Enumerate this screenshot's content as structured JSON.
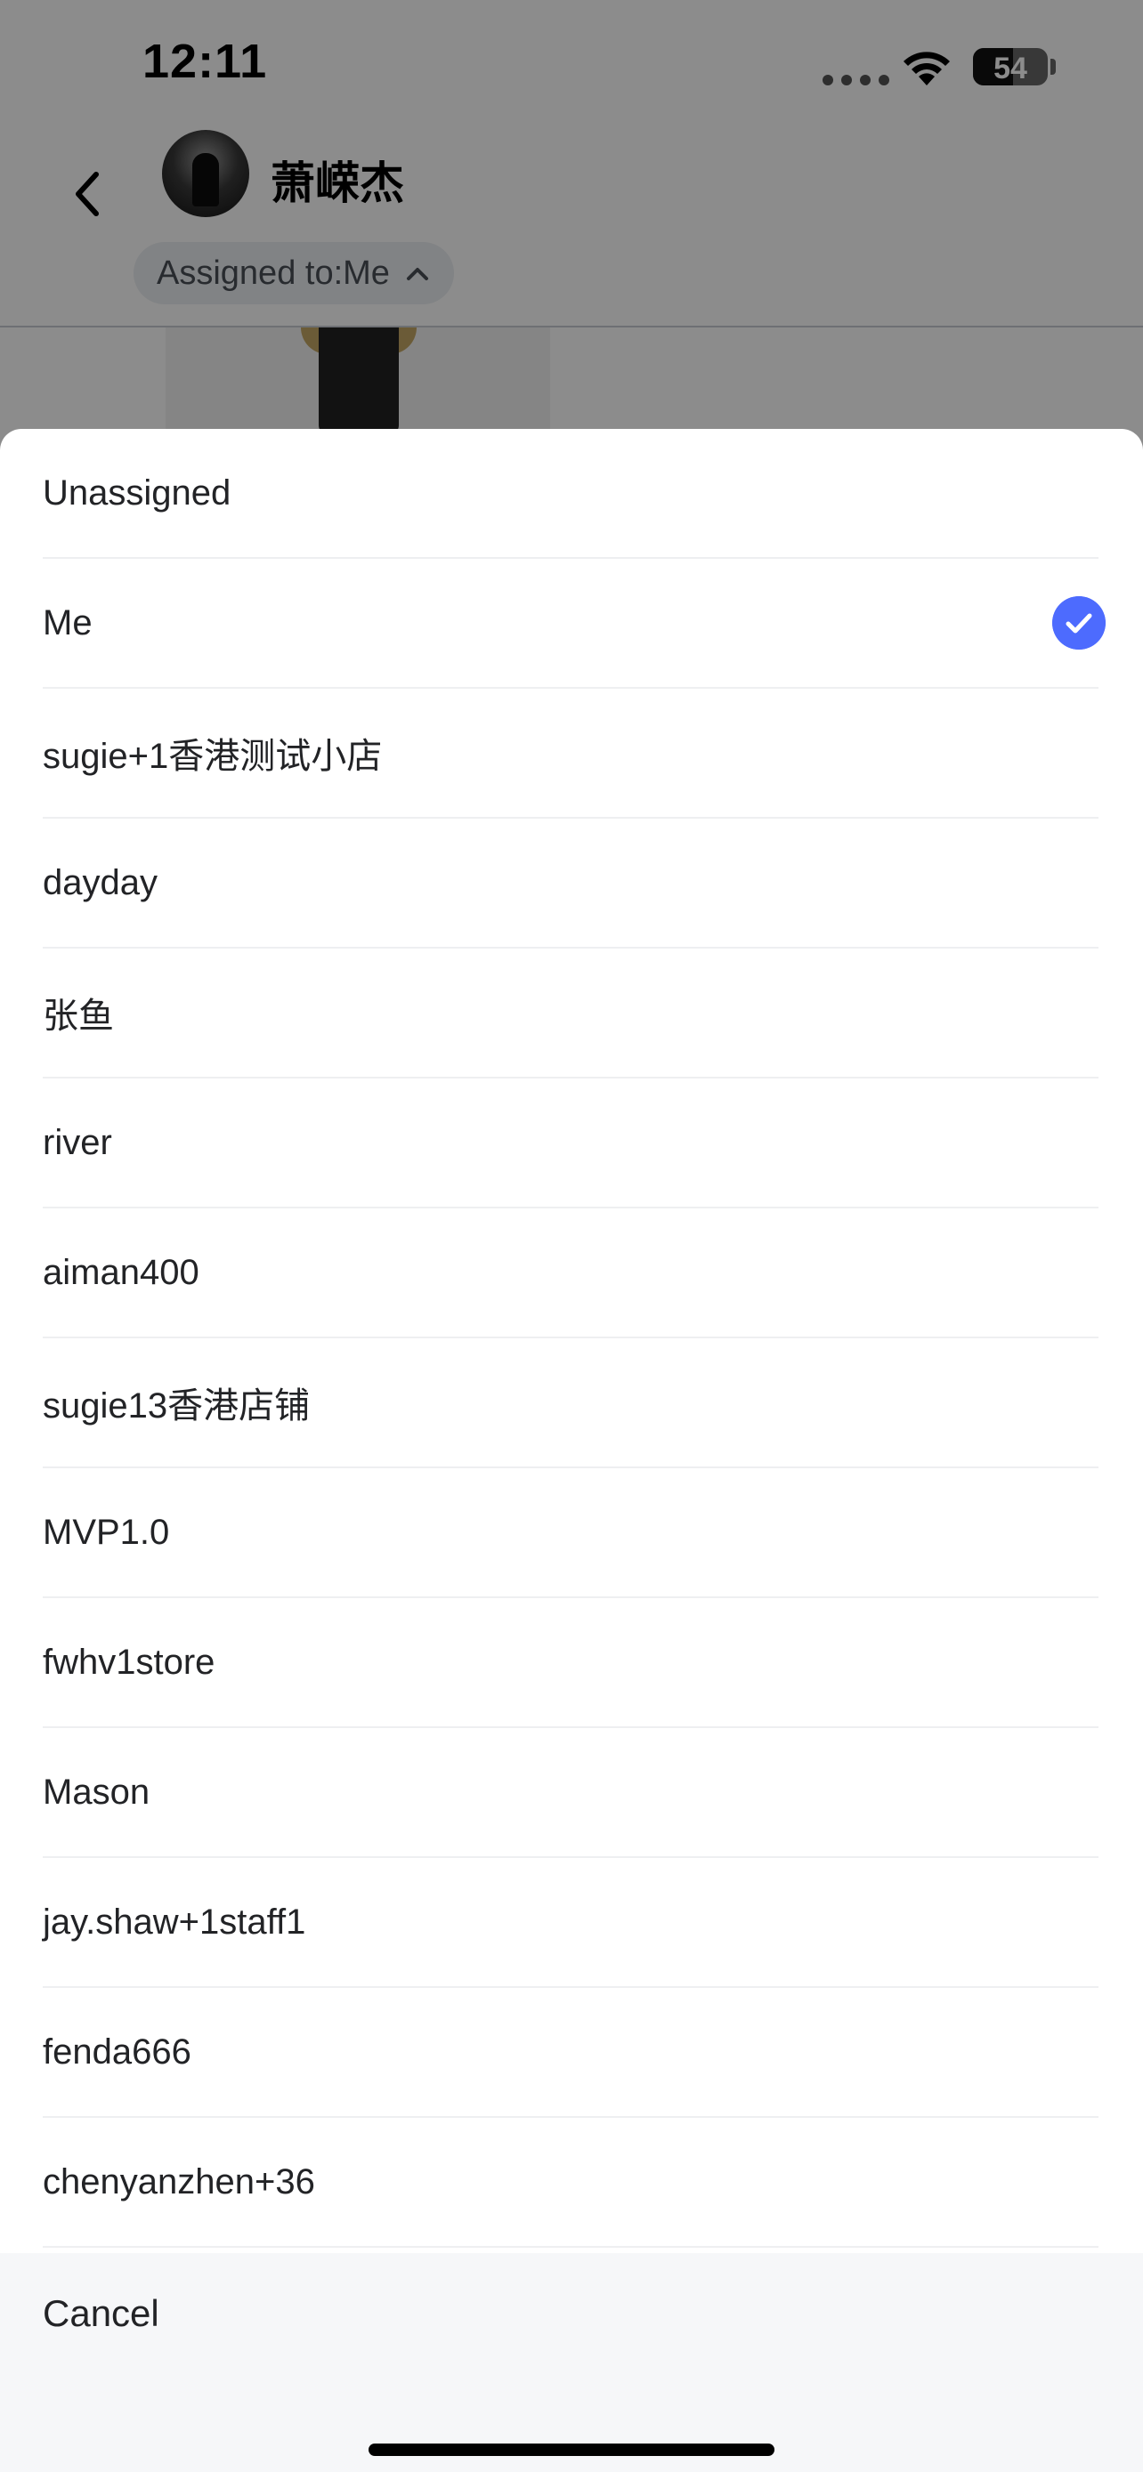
{
  "status_bar": {
    "time": "12:11",
    "battery": "54"
  },
  "header": {
    "contact_name": "萧嵘杰",
    "assigned_label": "Assigned to:Me"
  },
  "sheet": {
    "options": [
      {
        "label": "Unassigned",
        "selected": false
      },
      {
        "label": "Me",
        "selected": true
      },
      {
        "label": "sugie+1香港测试小店",
        "selected": false
      },
      {
        "label": "dayday",
        "selected": false
      },
      {
        "label": "张鱼",
        "selected": false
      },
      {
        "label": "river",
        "selected": false
      },
      {
        "label": "aiman400",
        "selected": false
      },
      {
        "label": "sugie13香港店铺",
        "selected": false
      },
      {
        "label": "MVP1.0",
        "selected": false
      },
      {
        "label": "fwhv1store",
        "selected": false
      },
      {
        "label": "Mason",
        "selected": false
      },
      {
        "label": "jay.shaw+1staff1",
        "selected": false
      },
      {
        "label": "fenda666",
        "selected": false
      },
      {
        "label": "chenyanzhen+36",
        "selected": false
      }
    ],
    "cancel_label": "Cancel"
  },
  "colors": {
    "accent": "#4d6bfe",
    "overlay": "rgba(0,0,0,0.45)"
  },
  "icons": [
    "back-icon",
    "wifi-icon",
    "battery-icon",
    "chevron-up-icon",
    "checkmark-icon"
  ]
}
